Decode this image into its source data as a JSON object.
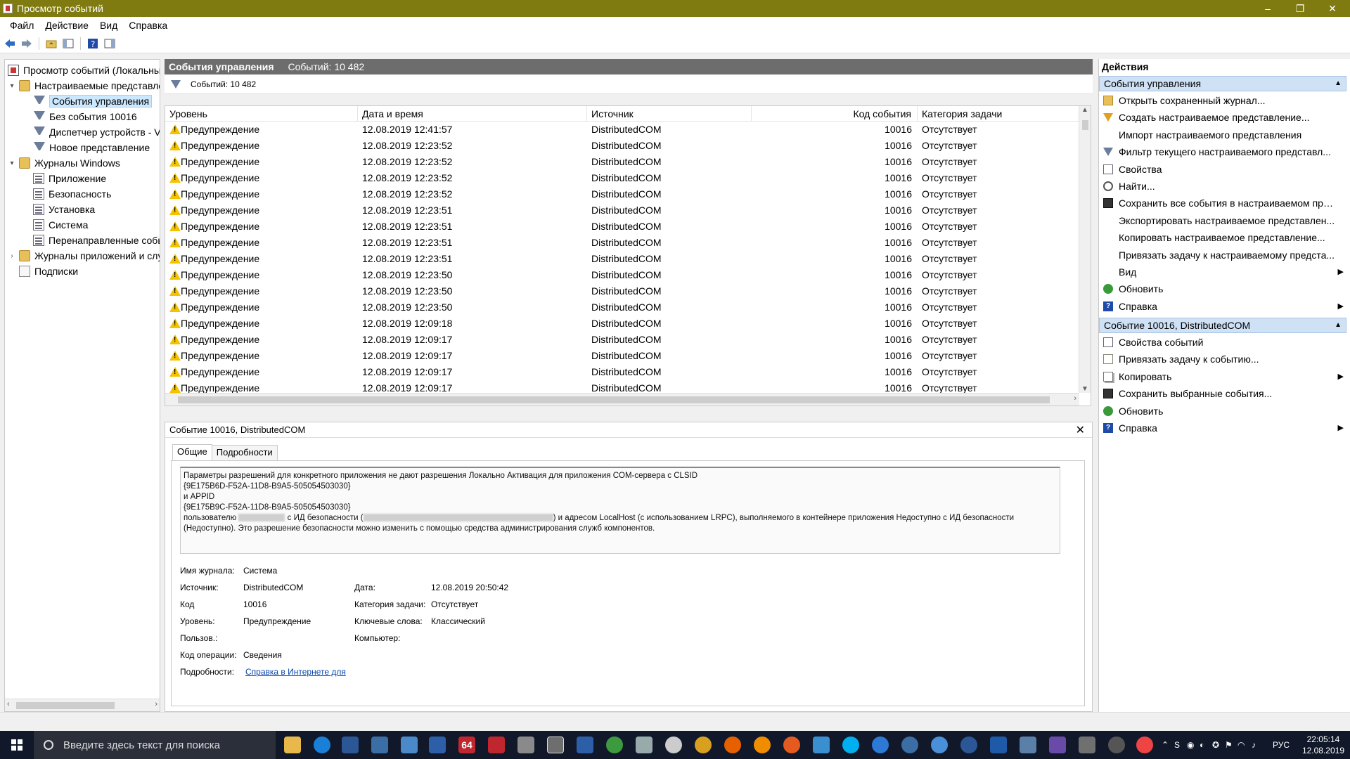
{
  "window": {
    "title": "Просмотр событий",
    "controls": {
      "minimize": "–",
      "restore": "❐",
      "close": "✕"
    }
  },
  "menu": [
    "Файл",
    "Действие",
    "Вид",
    "Справка"
  ],
  "tree": {
    "items": [
      {
        "label": "Просмотр событий (Локальный",
        "icon": "event-viewer-icon",
        "expander": ""
      },
      {
        "label": "Настраиваемые представле",
        "icon": "folder-icon",
        "expander": "▾"
      },
      {
        "label": "События управления",
        "icon": "filter-icon",
        "expander": "",
        "selected": true
      },
      {
        "label": "Без события 10016",
        "icon": "filter-icon",
        "expander": ""
      },
      {
        "label": "Диспетчер устройств - V",
        "icon": "filter-icon",
        "expander": ""
      },
      {
        "label": "Новое представление",
        "icon": "filter-icon",
        "expander": ""
      },
      {
        "label": "Журналы Windows",
        "icon": "folder-icon",
        "expander": "▾"
      },
      {
        "label": "Приложение",
        "icon": "log-icon",
        "expander": ""
      },
      {
        "label": "Безопасность",
        "icon": "log-icon",
        "expander": ""
      },
      {
        "label": "Установка",
        "icon": "log-icon",
        "expander": ""
      },
      {
        "label": "Система",
        "icon": "log-icon",
        "expander": ""
      },
      {
        "label": "Перенаправленные собы",
        "icon": "log-icon",
        "expander": ""
      },
      {
        "label": "Журналы приложений и слу",
        "icon": "folder-icon",
        "expander": "›"
      },
      {
        "label": "Подписки",
        "icon": "subscriptions-icon",
        "expander": ""
      }
    ]
  },
  "center": {
    "header_title": "События управления",
    "header_count": "Событий: 10 482",
    "filter_text": "Событий: 10 482",
    "columns": [
      "Уровень",
      "Дата и время",
      "Источник",
      "Код события",
      "Категория задачи"
    ],
    "rows": [
      [
        "Предупреждение",
        "12.08.2019 12:41:57",
        "DistributedCOM",
        "10016",
        "Отсутствует"
      ],
      [
        "Предупреждение",
        "12.08.2019 12:23:52",
        "DistributedCOM",
        "10016",
        "Отсутствует"
      ],
      [
        "Предупреждение",
        "12.08.2019 12:23:52",
        "DistributedCOM",
        "10016",
        "Отсутствует"
      ],
      [
        "Предупреждение",
        "12.08.2019 12:23:52",
        "DistributedCOM",
        "10016",
        "Отсутствует"
      ],
      [
        "Предупреждение",
        "12.08.2019 12:23:52",
        "DistributedCOM",
        "10016",
        "Отсутствует"
      ],
      [
        "Предупреждение",
        "12.08.2019 12:23:51",
        "DistributedCOM",
        "10016",
        "Отсутствует"
      ],
      [
        "Предупреждение",
        "12.08.2019 12:23:51",
        "DistributedCOM",
        "10016",
        "Отсутствует"
      ],
      [
        "Предупреждение",
        "12.08.2019 12:23:51",
        "DistributedCOM",
        "10016",
        "Отсутствует"
      ],
      [
        "Предупреждение",
        "12.08.2019 12:23:51",
        "DistributedCOM",
        "10016",
        "Отсутствует"
      ],
      [
        "Предупреждение",
        "12.08.2019 12:23:50",
        "DistributedCOM",
        "10016",
        "Отсутствует"
      ],
      [
        "Предупреждение",
        "12.08.2019 12:23:50",
        "DistributedCOM",
        "10016",
        "Отсутствует"
      ],
      [
        "Предупреждение",
        "12.08.2019 12:23:50",
        "DistributedCOM",
        "10016",
        "Отсутствует"
      ],
      [
        "Предупреждение",
        "12.08.2019 12:09:18",
        "DistributedCOM",
        "10016",
        "Отсутствует"
      ],
      [
        "Предупреждение",
        "12.08.2019 12:09:17",
        "DistributedCOM",
        "10016",
        "Отсутствует"
      ],
      [
        "Предупреждение",
        "12.08.2019 12:09:17",
        "DistributedCOM",
        "10016",
        "Отсутствует"
      ],
      [
        "Предупреждение",
        "12.08.2019 12:09:17",
        "DistributedCOM",
        "10016",
        "Отсутствует"
      ],
      [
        "Предупреждение",
        "12.08.2019 12:09:17",
        "DistributedCOM",
        "10016",
        "Отсутствует"
      ]
    ]
  },
  "detail": {
    "title": "Событие 10016, DistributedCOM",
    "tabs": [
      "Общие",
      "Подробности"
    ],
    "message_lines": [
      "Параметры разрешений для конкретного приложения не дают разрешения Локально Активация для приложения COM-сервера с CLSID",
      "{9E175B6D-F52A-11D8-B9A5-505054503030}",
      " и APPID",
      "{9E175B9C-F52A-11D8-B9A5-505054503030}"
    ],
    "message_user_prefix": " пользователю",
    "message_user_mid": "с ИД безопасности (",
    "message_user_suffix": ") и адресом LocalHost (с использованием LRPC), выполняемого в контейнере приложения Недоступно с ИД безопасности",
    "message_last": "(Недоступно). Это разрешение безопасности можно изменить с помощью средства администрирования служб компонентов.",
    "fields": {
      "log_name_label": "Имя журнала:",
      "log_name": "Система",
      "source_label": "Источник:",
      "source": "DistributedCOM",
      "date_label": "Дата:",
      "date": "12.08.2019 20:50:42",
      "code_label": "Код",
      "code": "10016",
      "task_label": "Категория задачи:",
      "task": "Отсутствует",
      "level_label": "Уровень:",
      "level": "Предупреждение",
      "keywords_label": "Ключевые слова:",
      "keywords": "Классический",
      "user_label": "Пользов.:",
      "computer_label": "Компьютер:",
      "opcode_label": "Код операции:",
      "opcode": "Сведения",
      "more_label": "Подробности:",
      "more_link": "Справка в Интернете для"
    }
  },
  "actions": {
    "title": "Действия",
    "section1": "События управления",
    "items1": [
      {
        "label": "Открыть сохраненный журнал...",
        "icon": "open-log-icon",
        "sub": ""
      },
      {
        "label": "Создать настраиваемое представление...",
        "icon": "create-view-icon",
        "sub": ""
      },
      {
        "label": "Импорт настраиваемого представления",
        "icon": "",
        "sub": ""
      },
      {
        "label": "Фильтр текущего настраиваемого представл...",
        "icon": "filter-icon",
        "sub": ""
      },
      {
        "label": "Свойства",
        "icon": "properties-icon",
        "sub": ""
      },
      {
        "label": "Найти...",
        "icon": "find-icon",
        "sub": ""
      },
      {
        "label": "Сохранить все события в настраиваемом пре...",
        "icon": "save-icon",
        "sub": ""
      },
      {
        "label": "Экспортировать настраиваемое представлен...",
        "icon": "",
        "sub": ""
      },
      {
        "label": "Копировать настраиваемое представление...",
        "icon": "",
        "sub": ""
      },
      {
        "label": "Привязать задачу к настраиваемому предста...",
        "icon": "",
        "sub": ""
      },
      {
        "label": "Вид",
        "icon": "",
        "sub": "▶"
      },
      {
        "label": "Обновить",
        "icon": "refresh-icon",
        "sub": ""
      },
      {
        "label": "Справка",
        "icon": "help-icon",
        "sub": "▶"
      }
    ],
    "section2": "Событие 10016, DistributedCOM",
    "items2": [
      {
        "label": "Свойства событий",
        "icon": "properties-icon",
        "sub": ""
      },
      {
        "label": "Привязать задачу к событию...",
        "icon": "task-icon",
        "sub": ""
      },
      {
        "label": "Копировать",
        "icon": "copy-icon",
        "sub": "▶"
      },
      {
        "label": "Сохранить выбранные события...",
        "icon": "save-icon",
        "sub": ""
      },
      {
        "label": "Обновить",
        "icon": "refresh-icon",
        "sub": ""
      },
      {
        "label": "Справка",
        "icon": "help-icon",
        "sub": "▶"
      }
    ]
  },
  "taskbar": {
    "search_placeholder": "Введите здесь текст для поиска",
    "badge_64": "64",
    "lang": "РУС",
    "time": "22:05:14",
    "date": "12.08.2019"
  },
  "colors": {
    "titlebar": "#7f7b11",
    "taskbar": "#10182a",
    "selection": "#cce8ff",
    "section": "#cfe1f5",
    "warning": "#f6c200",
    "link": "#0645ad"
  }
}
